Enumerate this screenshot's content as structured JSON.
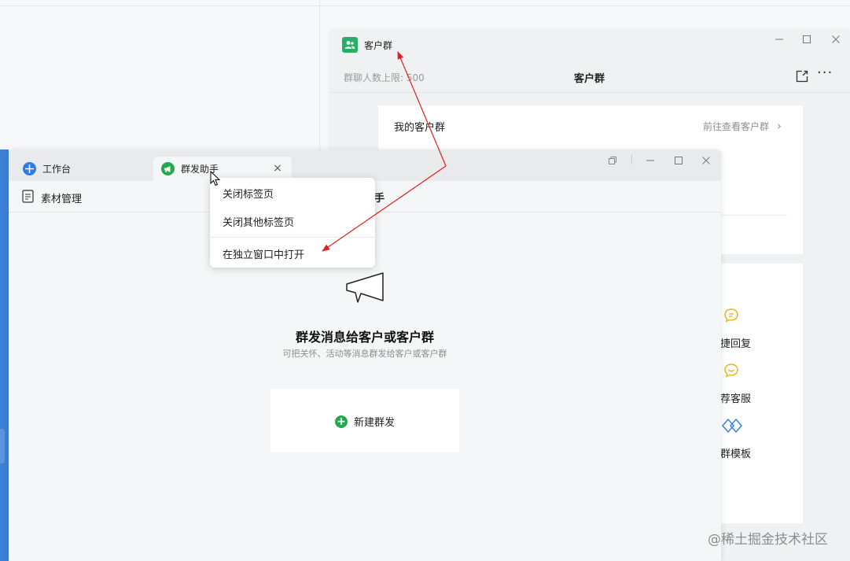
{
  "back_window": {
    "app_title": "客户群",
    "member_limit": "群聊人数上限: 500",
    "title": "客户群",
    "more_icon": "···",
    "my_groups_label": "我的客户群",
    "view_groups_link": "前往查看客户群",
    "chevron": "›",
    "quick_items": [
      {
        "label": "捷回复",
        "icon": "chat-bubble-icon"
      },
      {
        "label": "荐客服",
        "icon": "smile-bubble-icon"
      },
      {
        "label": "群模板",
        "icon": "diamond-links-icon"
      }
    ]
  },
  "front_window": {
    "tabs": [
      {
        "label": "工作台",
        "icon": "workbench-icon",
        "icon_color": "#2f7ae5"
      },
      {
        "label": "群发助手",
        "icon": "megaphone-icon",
        "icon_color": "#22a84e"
      }
    ],
    "tab_close": "×",
    "toolbar": {
      "material_label": "素材管理",
      "title_fragment": "手"
    },
    "empty_state": {
      "title": "群发消息给客户或客户群",
      "subtitle": "可把关怀、活动等消息群发给客户或客户群",
      "new_button_label": "新建群发",
      "plus": "+"
    }
  },
  "context_menu": {
    "items": [
      "关闭标签页",
      "关闭其他标签页",
      "在独立窗口中打开"
    ]
  },
  "watermark": "@稀土掘金技术社区",
  "colors": {
    "accent_green": "#22a84e",
    "accent_blue": "#2f7ae5",
    "annotation_red": "#e02020"
  }
}
